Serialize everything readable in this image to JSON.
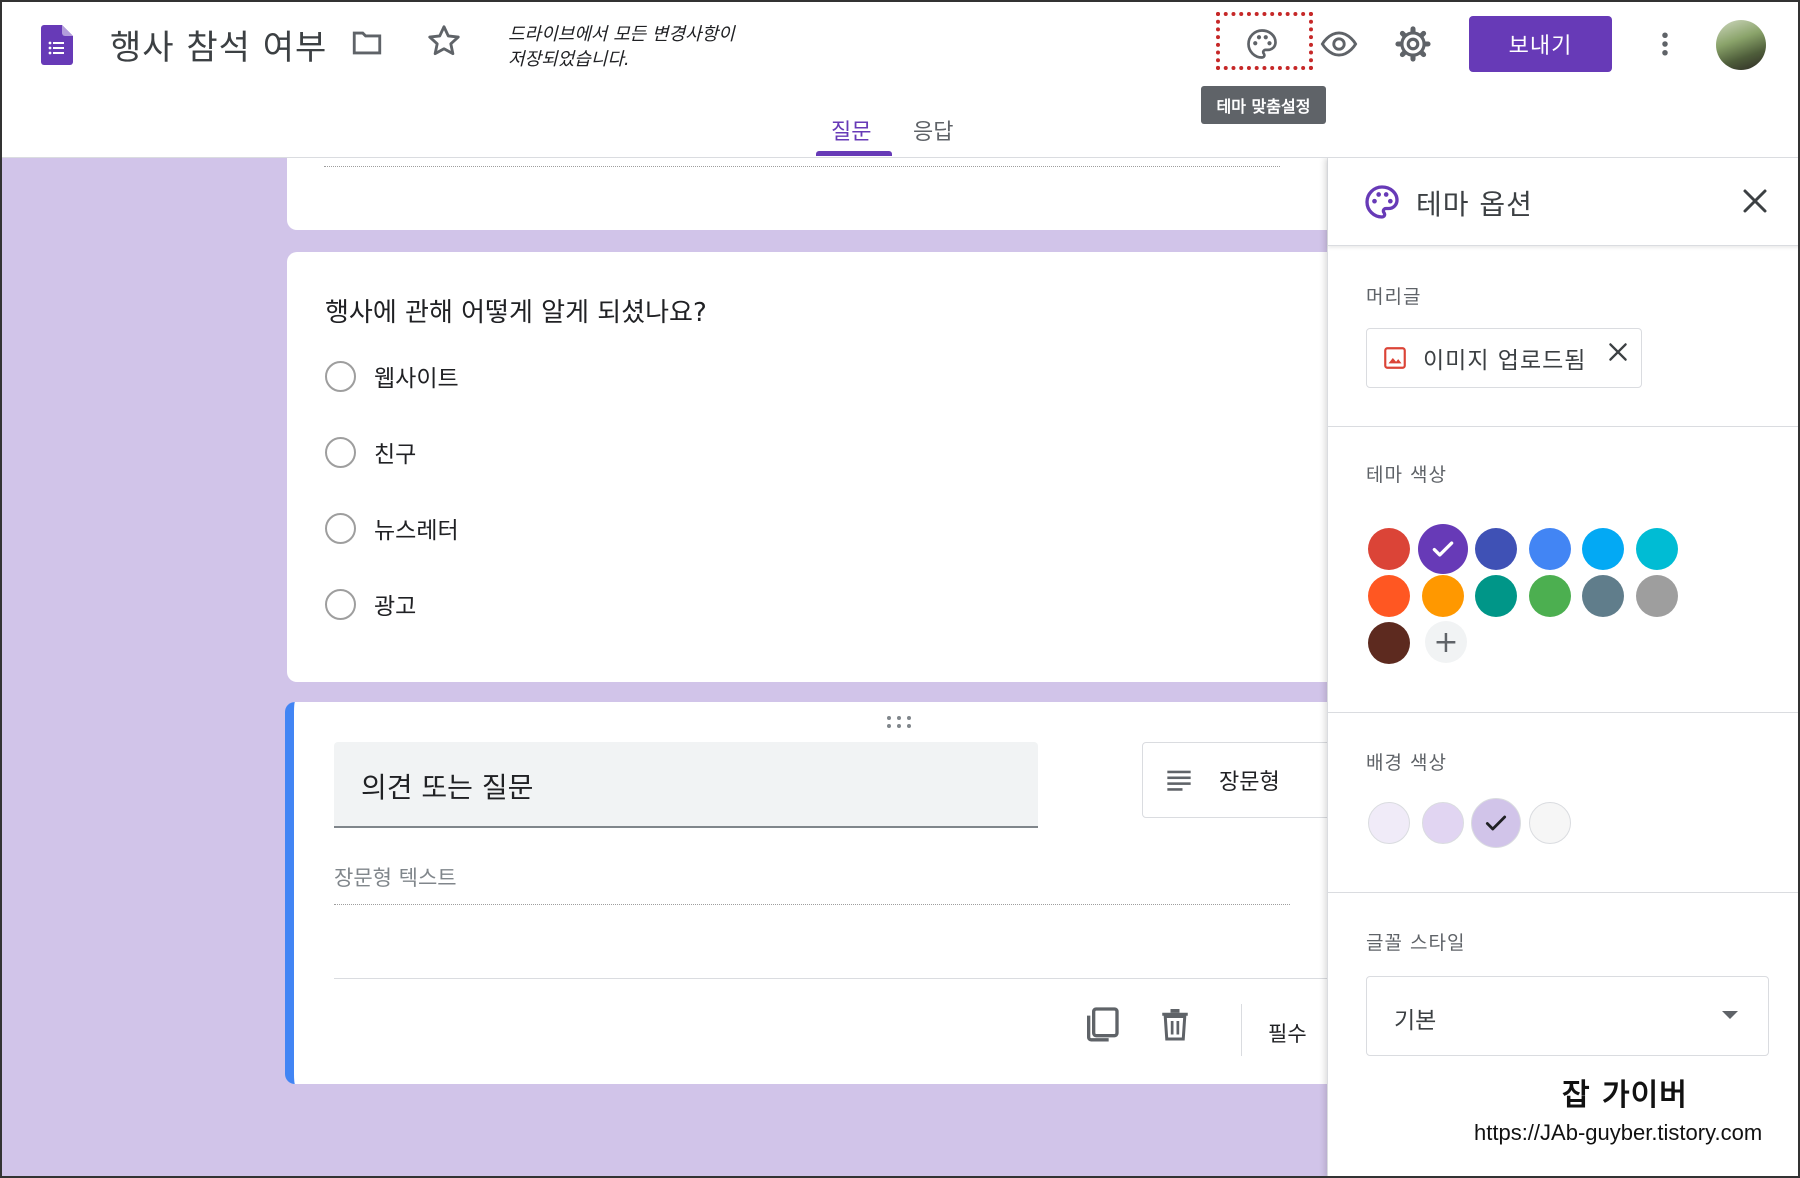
{
  "header": {
    "doc_title": "행사 참석 여부",
    "save_status": "드라이브에서 모든 변경사항이 저장되었습니다.",
    "tooltip": "테마 맞춤설정",
    "send_label": "보내기",
    "tabs": [
      {
        "label": "질문",
        "active": true
      },
      {
        "label": "응답",
        "active": false
      }
    ]
  },
  "question_card": {
    "title": "행사에 관해 어떻게 알게 되셨나요?",
    "options": [
      "웹사이트",
      "친구",
      "뉴스레터",
      "광고"
    ]
  },
  "edit_card": {
    "question_text": "의견 또는 질문",
    "question_type": "장문형",
    "answer_placeholder": "장문형 텍스트",
    "required_label": "필수"
  },
  "theme_panel": {
    "title": "테마 옵션",
    "header_label": "머리글",
    "header_image_chip": "이미지 업로드됨",
    "theme_color_label": "테마 색상",
    "theme_colors": [
      "#db4437",
      "#673ab7",
      "#3f51b5",
      "#4285f4",
      "#03a9f4",
      "#00bcd4",
      "#ff5722",
      "#ff9800",
      "#009688",
      "#4caf50",
      "#607d8b",
      "#9e9e9e",
      "#5d2a1f"
    ],
    "selected_theme_color": "#673ab7",
    "background_color_label": "배경 색상",
    "background_colors": [
      "#f0ebf8",
      "#e1d5f2",
      "#d1c4e9",
      "#f6f6f6"
    ],
    "selected_background_color": "#d1c4e9",
    "font_style_label": "글꼴 스타일",
    "font_style_value": "기본"
  },
  "watermark": {
    "name": "잡 가이버",
    "url": "https://JAb-guyber.tistory.com"
  }
}
